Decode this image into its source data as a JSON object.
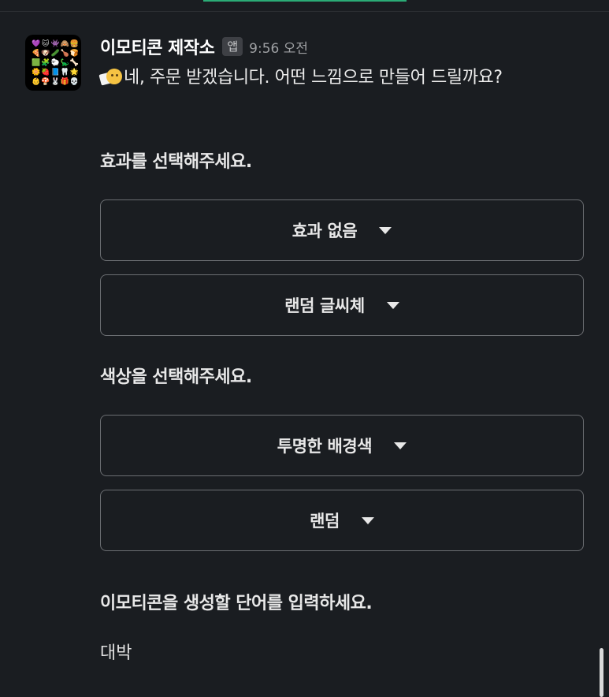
{
  "app": {
    "name": "이모티콘 제작소",
    "badge": "앱",
    "time": "9:56 오전"
  },
  "avatar": {
    "icon": "emoji-grid-icon",
    "glyphs": [
      "💜",
      "🐱",
      "👾",
      "🙈",
      "🍔",
      "🍕",
      "🐶",
      "🥒",
      "🍗",
      "🍞",
      "🟩",
      "🧩",
      "🐑",
      "🦕",
      "🦴",
      "🌼",
      "🍓",
      "📘",
      "🦷",
      "🌟",
      "👶",
      "🍄",
      "🐰",
      "🎁",
      "💀"
    ]
  },
  "message": {
    "emoji": "thinking-note-emoji",
    "text": "네, 주문 받겠습니다. 어떤 느낌으로 만들어 드릴까요?"
  },
  "effect_section": {
    "label": "효과를 선택해주세요.",
    "select_effect": "효과 없음",
    "select_font": "랜덤 글씨체"
  },
  "color_section": {
    "label": "색상을 선택해주세요.",
    "select_background": "투명한 배경색",
    "select_color": "랜덤"
  },
  "word_section": {
    "label": "이모티콘을 생성할 단어를 입력하세요.",
    "answer": "대박"
  },
  "colors": {
    "background": "#1a1d21",
    "accent": "#2bac76",
    "border": "#6b6e72"
  }
}
